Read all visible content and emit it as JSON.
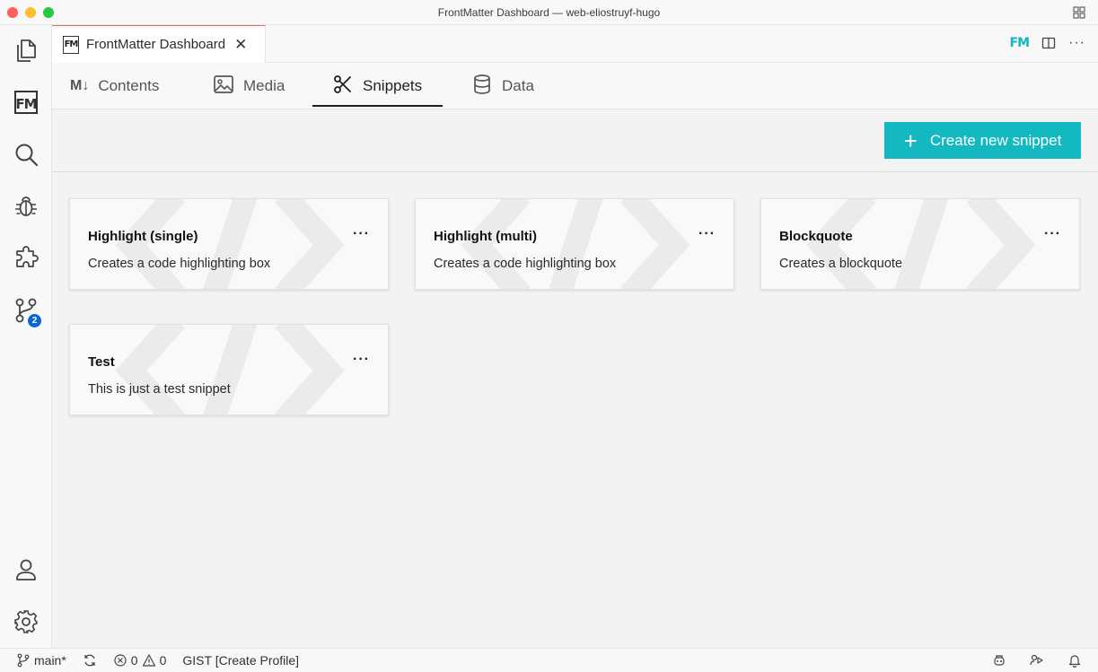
{
  "window": {
    "title": "FrontMatter Dashboard — web-eliostruyf-hugo"
  },
  "activity_bar": {
    "items": [
      "explorer-icon",
      "frontmatter-icon",
      "search-icon",
      "debug-icon",
      "extensions-icon",
      "source-control-icon"
    ],
    "source_control_badge": "2",
    "bottom": [
      "account-icon",
      "settings-icon"
    ]
  },
  "editor_tab": {
    "logo": "FM",
    "label": "FrontMatter Dashboard",
    "close": "✕"
  },
  "tab_actions": {
    "fm": "FM",
    "more": "···"
  },
  "nav": {
    "tabs": [
      {
        "label": "Contents",
        "icon_text": "M↓"
      },
      {
        "label": "Media"
      },
      {
        "label": "Snippets"
      },
      {
        "label": "Data"
      }
    ],
    "active": "Snippets"
  },
  "toolbar": {
    "create_label": "Create new snippet",
    "create_icon": "+"
  },
  "snippets": [
    {
      "title": "Highlight (single)",
      "description": "Creates a code highlighting box",
      "menu": "···"
    },
    {
      "title": "Highlight (multi)",
      "description": "Creates a code highlighting box",
      "menu": "···"
    },
    {
      "title": "Blockquote",
      "description": "Creates a blockquote",
      "menu": "···"
    },
    {
      "title": "Test",
      "description": "This is just a test snippet",
      "menu": "···"
    }
  ],
  "status_bar": {
    "branch": "main*",
    "errors": "0",
    "warnings": "0",
    "gist": "GIST [Create Profile]"
  },
  "colors": {
    "accent": "#14b8c0",
    "badge": "#0a66d1",
    "fm_accent": "#0fb8bf"
  }
}
